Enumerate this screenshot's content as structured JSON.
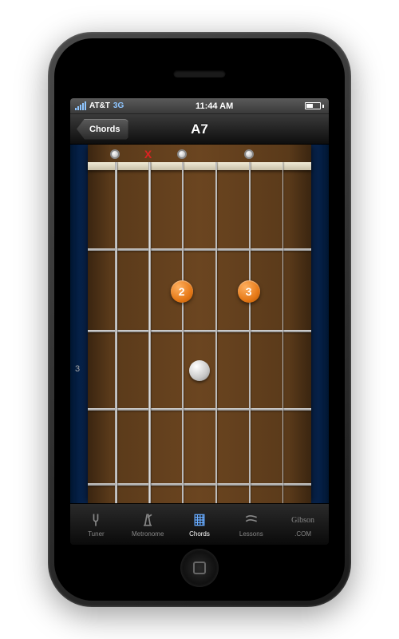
{
  "status_bar": {
    "carrier": "AT&T",
    "network": "3G",
    "time": "11:44 AM"
  },
  "nav": {
    "back_label": "Chords",
    "title": "A7"
  },
  "fretboard": {
    "fret_label": "3",
    "string_markers": [
      "open",
      "mute",
      "open",
      "blank",
      "open",
      "blank"
    ],
    "fingers": [
      {
        "string": 4,
        "fret": 2,
        "label": "2"
      },
      {
        "string": 2,
        "fret": 2,
        "label": "3"
      }
    ]
  },
  "tabs": {
    "items": [
      {
        "label": "Tuner"
      },
      {
        "label": "Metronome"
      },
      {
        "label": "Chords"
      },
      {
        "label": "Lessons"
      },
      {
        "label": ".COM"
      }
    ],
    "active_index": 2
  }
}
